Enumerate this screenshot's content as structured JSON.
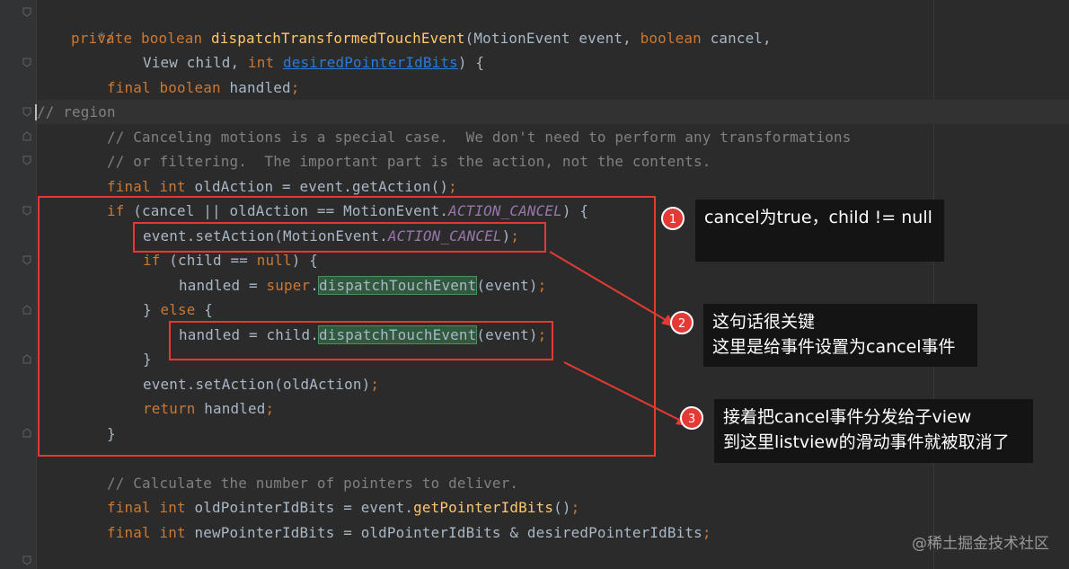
{
  "code": {
    "l1": {
      "comment": " */"
    },
    "l2": {
      "kw_private": "private",
      "kw_boolean": "boolean",
      "method": "dispatchTransformedTouchEvent",
      "open": "(MotionEvent event, ",
      "kw_boolean2": "boolean",
      "cancel": " cancel,",
      "comma": ""
    },
    "l3": {
      "view_child": "View child, ",
      "kw_int": "int",
      "space": " ",
      "param_link": "desiredPointerIdBits",
      "close": ") {"
    },
    "l4": {
      "kw_final": "final",
      "kw_boolean": "boolean",
      "rest": " handled",
      "semi": ";"
    },
    "l5": {
      "comment": "// region"
    },
    "l6": {
      "comment": "// Canceling motions is a special case.  We don't need to perform any transformations"
    },
    "l7": {
      "comment": "// or filtering.  The important part is the action, not the contents."
    },
    "l8": {
      "kw_final": "final",
      "kw_int": "int",
      "rest": " oldAction = event.getAction()",
      "semi": ";"
    },
    "l9": {
      "kw_if": "if",
      "pre": " (cancel || oldAction == MotionEvent.",
      "const": "ACTION_CANCEL",
      "post": ") {"
    },
    "l10": {
      "pre": "event.setAction(MotionEvent.",
      "const": "ACTION_CANCEL",
      "post": ")",
      "semi": ";"
    },
    "l11": {
      "kw_if": "if",
      "pre": " (child == ",
      "kw_null": "null",
      "post": ") {"
    },
    "l12": {
      "pre": "handled = ",
      "kw_super": "super",
      "dot": ".",
      "hl": "dispatchTouchEvent",
      "post": "(event)",
      "semi": ";"
    },
    "l13": {
      "pre": "} ",
      "kw_else": "else",
      "post": " {"
    },
    "l14": {
      "pre": "handled = child.",
      "hl": "dispatchTouchEvent",
      "post": "(event)",
      "semi": ";"
    },
    "l15": {
      "text": "}"
    },
    "l16": {
      "pre": "event.setAction(oldAction)",
      "semi": ";"
    },
    "l17": {
      "kw_return": "return",
      "post": " handled",
      "semi": ";"
    },
    "l18": {
      "text": "}"
    },
    "l19": {
      "comment": "// Calculate the number of pointers to deliver."
    },
    "l20": {
      "kw_final": "final",
      "kw_int": "int",
      "pre": " oldPointerIdBits = event.",
      "fn": "getPointerIdBits",
      "post": "()",
      "semi": ";"
    },
    "l21": {
      "kw_final": "final",
      "kw_int": "int",
      "pre": " newPointerIdBits = oldPointerIdBits & desiredPointerIdBits",
      "semi": ";"
    }
  },
  "annotations": [
    {
      "number": "1",
      "lines": [
        "cancel为true，child != null"
      ]
    },
    {
      "number": "2",
      "lines": [
        "这句话很关键",
        "这里是给事件设置为cancel事件"
      ]
    },
    {
      "number": "3",
      "lines": [
        "接着把cancel事件分发给子view",
        "到这里listview的滑动事件就被取消了"
      ]
    }
  ],
  "watermark": "@稀土掘金技术社区",
  "colors": {
    "annotation_red": "#e53935",
    "editor_bg": "#2b2b2b",
    "keyword": "#cc7832",
    "comment": "#808080",
    "constant": "#9876aa",
    "method": "#ffc66d"
  }
}
